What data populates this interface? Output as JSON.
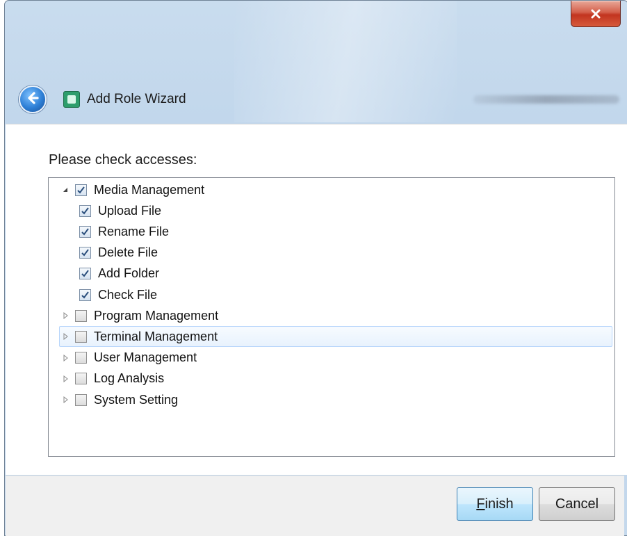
{
  "window": {
    "title": "Add Role Wizard",
    "close_symbol": "x"
  },
  "icons": {
    "back": "back-arrow-icon",
    "app": "wizard-app-icon",
    "close": "close-icon",
    "expanded": "triangle-down-icon",
    "collapsed": "triangle-right-icon",
    "check": "checkmark-icon"
  },
  "content": {
    "prompt": "Please check accesses:"
  },
  "tree": {
    "items": [
      {
        "label": "Media Management",
        "checked": true,
        "expandable": true,
        "expanded": true,
        "level": 0,
        "selected": false
      },
      {
        "label": "Upload File",
        "checked": true,
        "expandable": false,
        "expanded": false,
        "level": 1,
        "selected": false
      },
      {
        "label": "Rename File",
        "checked": true,
        "expandable": false,
        "expanded": false,
        "level": 1,
        "selected": false
      },
      {
        "label": "Delete File",
        "checked": true,
        "expandable": false,
        "expanded": false,
        "level": 1,
        "selected": false
      },
      {
        "label": "Add Folder",
        "checked": true,
        "expandable": false,
        "expanded": false,
        "level": 1,
        "selected": false
      },
      {
        "label": "Check File",
        "checked": true,
        "expandable": false,
        "expanded": false,
        "level": 1,
        "selected": false
      },
      {
        "label": "Program Management",
        "checked": false,
        "expandable": true,
        "expanded": false,
        "level": 0,
        "selected": false
      },
      {
        "label": "Terminal Management",
        "checked": false,
        "expandable": true,
        "expanded": false,
        "level": 0,
        "selected": true
      },
      {
        "label": "User Management",
        "checked": false,
        "expandable": true,
        "expanded": false,
        "level": 0,
        "selected": false
      },
      {
        "label": "Log Analysis",
        "checked": false,
        "expandable": true,
        "expanded": false,
        "level": 0,
        "selected": false
      },
      {
        "label": "System Setting",
        "checked": false,
        "expandable": true,
        "expanded": false,
        "level": 0,
        "selected": false
      }
    ]
  },
  "footer": {
    "finish_accel": "F",
    "finish_rest": "inish",
    "cancel_label": "Cancel"
  },
  "colors": {
    "titlebar": "#bcd3ea",
    "close_button": "#c2341f",
    "selection_border": "#b8d6fb",
    "finish_button": "#a7d9f5"
  }
}
